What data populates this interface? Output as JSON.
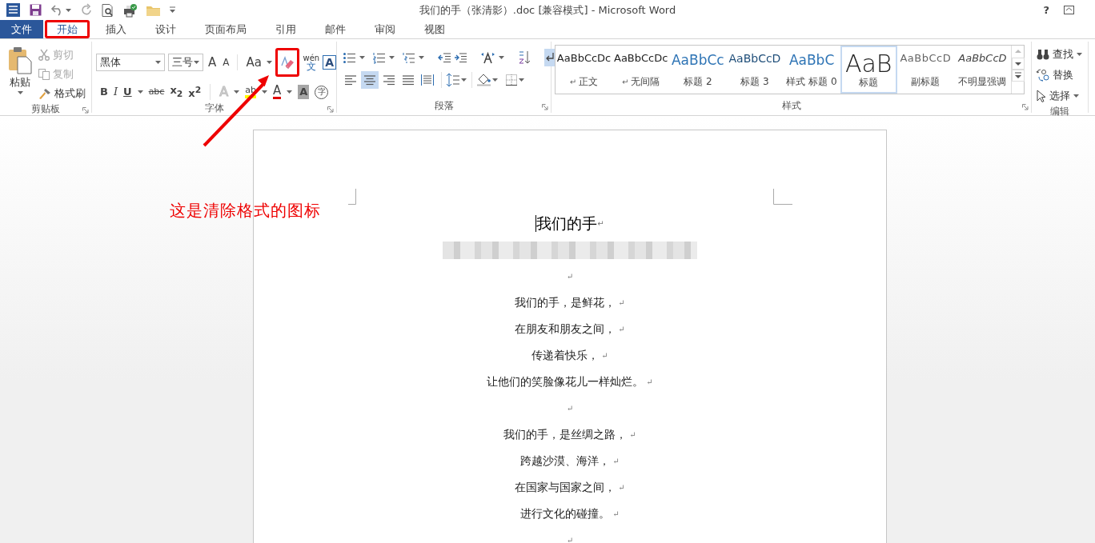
{
  "window": {
    "title": "我们的手（张清影）.doc [兼容模式] - Microsoft Word",
    "help": "?"
  },
  "tabs": [
    {
      "label": "文件",
      "kind": "file",
      "selected": false,
      "highlighted": false
    },
    {
      "label": "开始",
      "kind": "tab",
      "selected": true,
      "highlighted": true
    },
    {
      "label": "插入",
      "kind": "tab",
      "selected": false,
      "highlighted": false
    },
    {
      "label": "设计",
      "kind": "tab",
      "selected": false,
      "highlighted": false
    },
    {
      "label": "页面布局",
      "kind": "tab",
      "selected": false,
      "highlighted": false
    },
    {
      "label": "引用",
      "kind": "tab",
      "selected": false,
      "highlighted": false
    },
    {
      "label": "邮件",
      "kind": "tab",
      "selected": false,
      "highlighted": false
    },
    {
      "label": "审阅",
      "kind": "tab",
      "selected": false,
      "highlighted": false
    },
    {
      "label": "视图",
      "kind": "tab",
      "selected": false,
      "highlighted": false
    }
  ],
  "clipboard": {
    "group": "剪贴板",
    "paste": "粘贴",
    "items": [
      {
        "kind": "cut",
        "label": "剪切",
        "disabled": true
      },
      {
        "kind": "copy",
        "label": "复制",
        "disabled": true
      },
      {
        "kind": "painter",
        "label": "格式刷",
        "disabled": false
      }
    ]
  },
  "font": {
    "group": "字体",
    "name": "黑体",
    "size": "三号",
    "row1": [
      {
        "kind": "grow",
        "text": "A"
      },
      {
        "kind": "shrink",
        "text": "A"
      },
      {
        "kind": "case",
        "text": "Aa"
      },
      {
        "kind": "clear",
        "highlighted": true
      },
      {
        "kind": "phonetic",
        "text": "wén",
        "sub": "文"
      },
      {
        "kind": "border",
        "text": "A"
      }
    ],
    "row2": [
      {
        "kind": "bold",
        "text": "B"
      },
      {
        "kind": "italic",
        "text": "I"
      },
      {
        "kind": "underline",
        "text": "U"
      },
      {
        "kind": "strike",
        "text": "abc"
      },
      {
        "kind": "script",
        "text": "x$_{2}$"
      },
      {
        "kind": "script",
        "text": "x$^{2}$"
      },
      {
        "kind": "effects",
        "text": "A"
      },
      {
        "kind": "highlight",
        "text": "ab"
      },
      {
        "kind": "color",
        "text": "A"
      },
      {
        "kind": "shading",
        "text": "A"
      },
      {
        "kind": "enclose",
        "text": "字"
      }
    ]
  },
  "paragraph": {
    "group": "段落",
    "show_marks": {
      "on": true
    },
    "alignments": [
      {
        "kind": "left",
        "selected": false
      },
      {
        "kind": "center",
        "selected": true
      },
      {
        "kind": "right",
        "selected": false
      },
      {
        "kind": "justify",
        "selected": false
      },
      {
        "kind": "distributed",
        "selected": false
      }
    ]
  },
  "styles": {
    "group": "样式",
    "items": [
      {
        "sample": "AaBbCcDc",
        "label": "正文",
        "mark": "↵",
        "kind": "plain",
        "selected": false
      },
      {
        "sample": "AaBbCcDc",
        "label": "无间隔",
        "mark": "↵",
        "kind": "plain",
        "selected": false
      },
      {
        "sample": "AaBbCc",
        "label": "标题 2",
        "kind": "heading",
        "selected": false
      },
      {
        "sample": "AaBbCcD",
        "label": "标题 3",
        "kind": "heading3",
        "selected": false
      },
      {
        "sample": "AaBbC",
        "label": "样式 标题 0",
        "kind": "heading",
        "selected": false
      },
      {
        "sample": "AaB",
        "label": "标题",
        "kind": "title",
        "selected": true
      },
      {
        "sample": "AaBbCcD",
        "label": "副标题",
        "kind": "subtitle",
        "selected": false
      },
      {
        "sample": "AaBbCcD",
        "label": "不明显强调",
        "kind": "emphasis",
        "selected": false
      }
    ]
  },
  "editing": {
    "group": "编辑",
    "items": [
      {
        "kind": "find",
        "label": "查找"
      },
      {
        "kind": "replace",
        "label": "替换"
      },
      {
        "kind": "select",
        "label": "选择"
      }
    ]
  },
  "annotation": {
    "text": "这是清除格式的图标"
  },
  "document": {
    "title": "我们的手",
    "title_mark": "↵",
    "lines": [
      {
        "mark": "↵"
      },
      {
        "text": "我们的手，是鲜花，",
        "mark": "↵"
      },
      {
        "text": "在朋友和朋友之间，",
        "mark": "↵"
      },
      {
        "text": "传递着快乐，",
        "mark": "↵"
      },
      {
        "text": "让他们的笑脸像花儿一样灿烂。",
        "mark": "↵"
      },
      {
        "mark": "↵"
      },
      {
        "text": "我们的手，是丝绸之路，",
        "mark": "↵"
      },
      {
        "text": "跨越沙漠、海洋，",
        "mark": "↵"
      },
      {
        "text": "在国家与国家之间，",
        "mark": "↵"
      },
      {
        "text": "进行文化的碰撞。",
        "mark": "↵"
      },
      {
        "mark": "↵"
      }
    ]
  }
}
